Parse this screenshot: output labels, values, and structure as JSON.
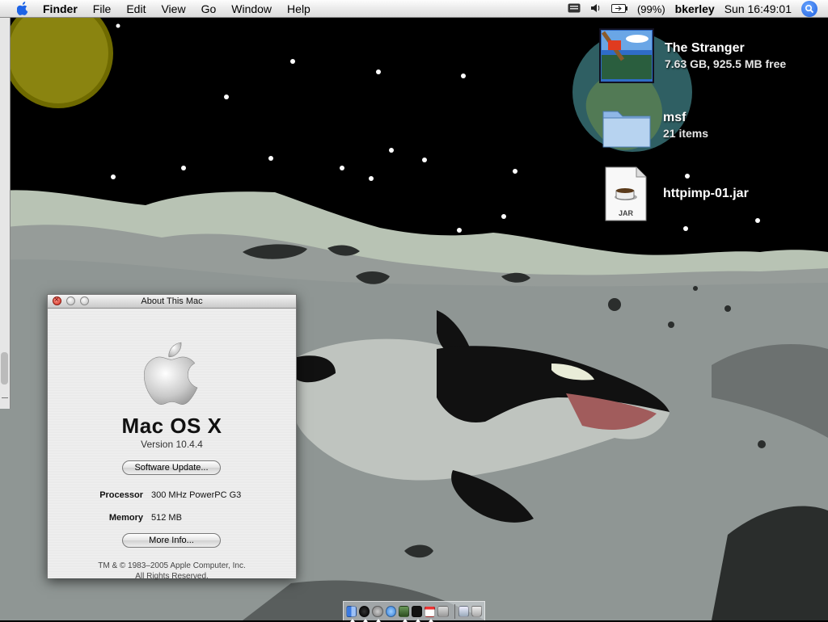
{
  "menubar": {
    "app_name": "Finder",
    "menus": [
      "File",
      "Edit",
      "View",
      "Go",
      "Window",
      "Help"
    ],
    "battery": "(99%)",
    "user": "bkerley",
    "clock": "Sun 16:49:01"
  },
  "desktop_icons": [
    {
      "name": "The Stranger",
      "info": "7.63 GB, 925.5 MB free",
      "icon": "hard-drive-icon"
    },
    {
      "name": "msf",
      "info": "21 items",
      "icon": "folder-icon"
    },
    {
      "name": "httpimp-01.jar",
      "info": "",
      "icon": "jar-file-icon",
      "badge": "JAR"
    }
  ],
  "about": {
    "title": "About This Mac",
    "os_name": "Mac OS X",
    "version": "Version 10.4.4",
    "software_update_label": "Software Update...",
    "processor_label": "Processor",
    "processor_value": "300 MHz PowerPC G3",
    "memory_label": "Memory",
    "memory_value": "512 MB",
    "more_info_label": "More Info...",
    "copyright_line1": "TM & © 1983–2005 Apple Computer, Inc.",
    "copyright_line2": "All Rights Reserved."
  },
  "dock": {
    "items": [
      "finder-icon",
      "dashboard-icon",
      "system-prefs-icon",
      "safari-icon",
      "utility-icon",
      "terminal-icon",
      "ical-icon",
      "app-icon",
      "mail-icon",
      "trash-icon"
    ]
  },
  "colors": {
    "accent": "#1d5ee0",
    "close_button": "#d12a1d"
  }
}
